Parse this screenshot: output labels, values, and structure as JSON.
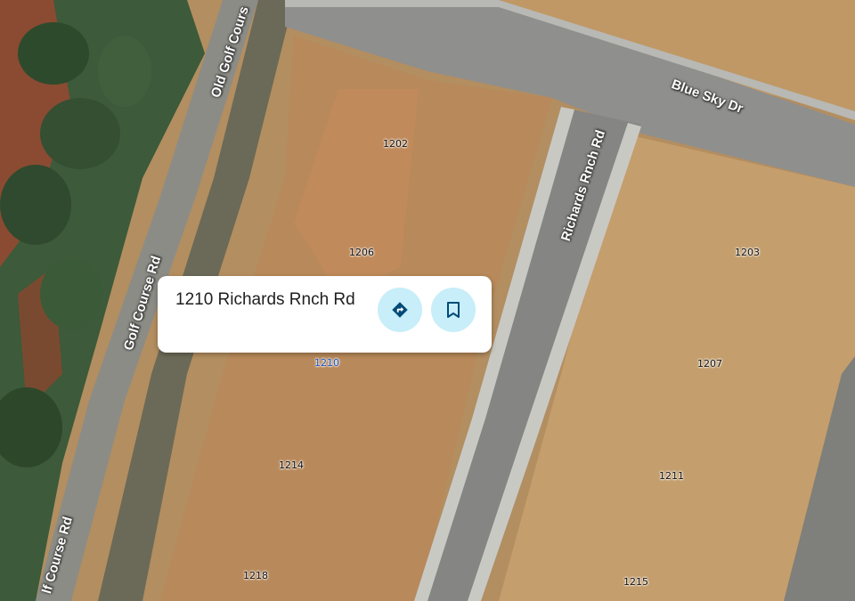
{
  "map": {
    "roads": {
      "old_golf_course": "Old Golf Cours",
      "golf_course_upper": "Golf Course Rd",
      "golf_course_lower": "lf Course Rd",
      "blue_sky": "Blue Sky Dr",
      "richards_rnch": "Richards Rnch Rd"
    },
    "addresses": {
      "a1202": "1202",
      "a1206": "1206",
      "a1210": "1210",
      "a1214": "1214",
      "a1218": "1218",
      "a1203": "1203",
      "a1207": "1207",
      "a1211": "1211",
      "a1215": "1215"
    }
  },
  "place_card": {
    "title": "1210 Richards Rnch Rd",
    "directions_icon": "directions-icon",
    "save_icon": "bookmark-icon",
    "accent_color": "#c7eef9",
    "icon_color": "#004a77"
  }
}
